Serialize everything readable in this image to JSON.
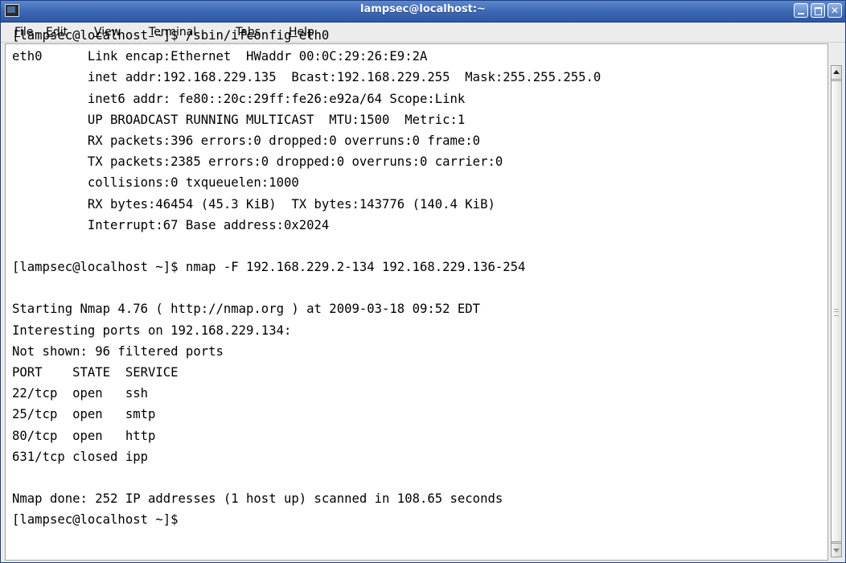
{
  "window": {
    "title": "lampsec@localhost:~"
  },
  "menu": {
    "items": [
      {
        "pre": "",
        "mnemonic": "F",
        "post": "ile"
      },
      {
        "pre": "",
        "mnemonic": "E",
        "post": "dit"
      },
      {
        "pre": "",
        "mnemonic": "V",
        "post": "iew"
      },
      {
        "pre": "",
        "mnemonic": "T",
        "post": "erminal"
      },
      {
        "pre": "Ta",
        "mnemonic": "b",
        "post": "s"
      },
      {
        "pre": "",
        "mnemonic": "H",
        "post": "elp"
      }
    ]
  },
  "terminal": {
    "lines": [
      "[lampsec@localhost ~]$ /sbin/ifconfig eth0",
      "eth0      Link encap:Ethernet  HWaddr 00:0C:29:26:E9:2A",
      "          inet addr:192.168.229.135  Bcast:192.168.229.255  Mask:255.255.255.0",
      "          inet6 addr: fe80::20c:29ff:fe26:e92a/64 Scope:Link",
      "          UP BROADCAST RUNNING MULTICAST  MTU:1500  Metric:1",
      "          RX packets:396 errors:0 dropped:0 overruns:0 frame:0",
      "          TX packets:2385 errors:0 dropped:0 overruns:0 carrier:0",
      "          collisions:0 txqueuelen:1000",
      "          RX bytes:46454 (45.3 KiB)  TX bytes:143776 (140.4 KiB)",
      "          Interrupt:67 Base address:0x2024",
      "",
      "[lampsec@localhost ~]$ nmap -F 192.168.229.2-134 192.168.229.136-254",
      "",
      "Starting Nmap 4.76 ( http://nmap.org ) at 2009-03-18 09:52 EDT",
      "Interesting ports on 192.168.229.134:",
      "Not shown: 96 filtered ports",
      "PORT    STATE  SERVICE",
      "22/tcp  open   ssh",
      "25/tcp  open   smtp",
      "80/tcp  open   http",
      "631/tcp closed ipp",
      "",
      "Nmap done: 252 IP addresses (1 host up) scanned in 108.65 seconds",
      "[lampsec@localhost ~]$"
    ]
  }
}
